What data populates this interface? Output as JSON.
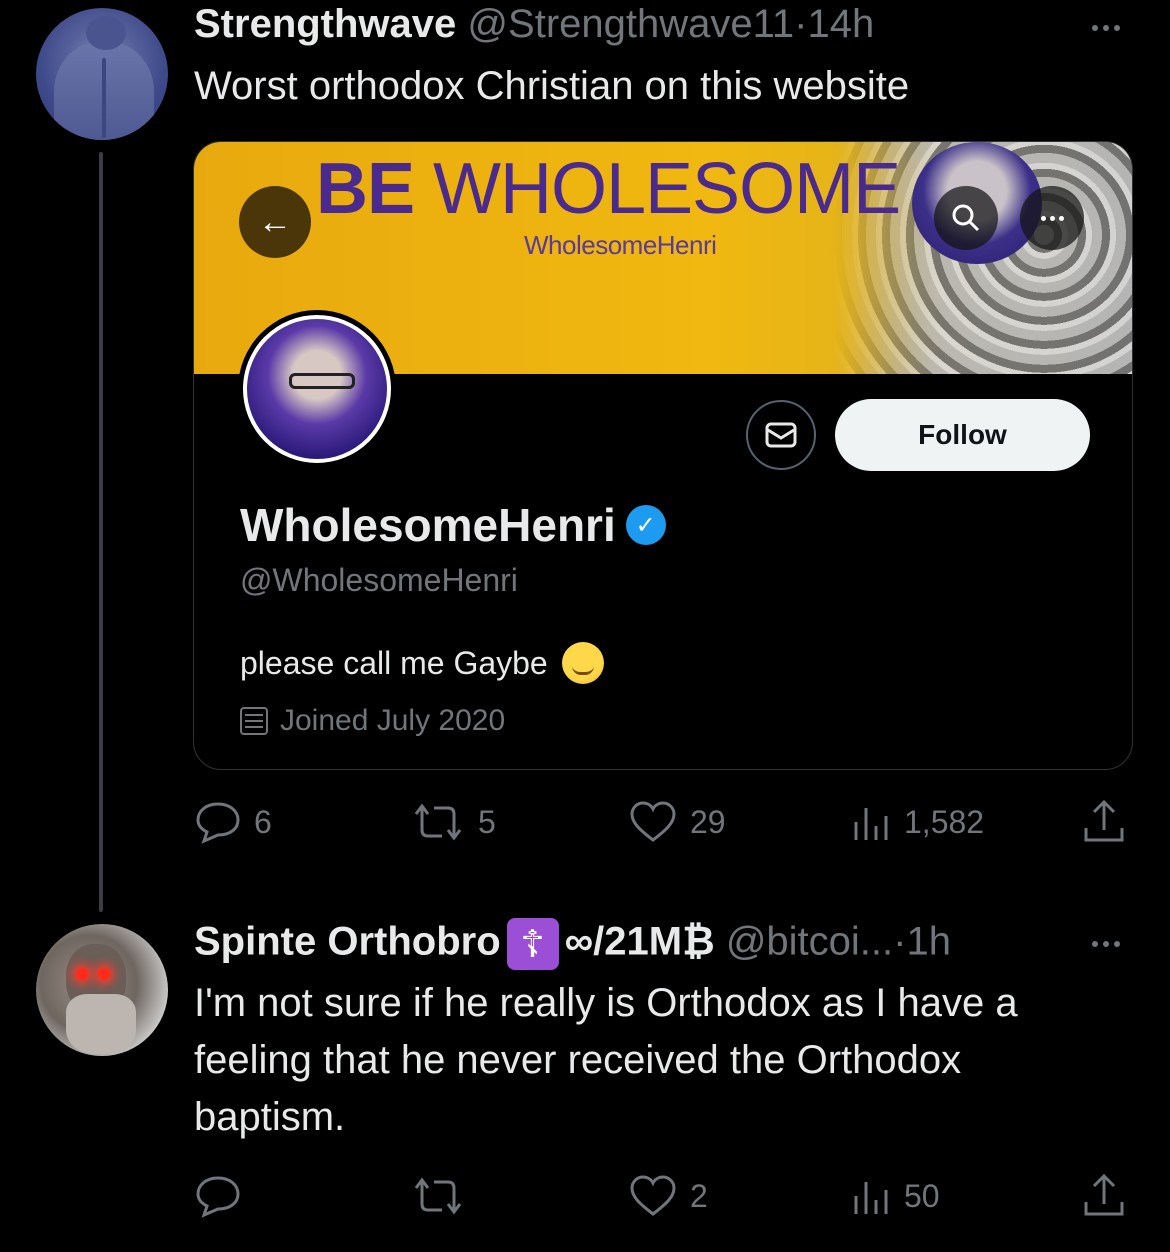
{
  "tweet1": {
    "name": "Strengthwave",
    "handle": "@Strengthwave11",
    "sep": "·",
    "time": "14h",
    "text": "Worst orthodox Christian on this website",
    "card": {
      "banner_title_bold": "BE",
      "banner_title_rest": " WHOLESOME",
      "banner_subtitle": "WholesomeHenri",
      "follow_label": "Follow",
      "display_name": "WholesomeHenri",
      "verified_mark": "✓",
      "handle": "@WholesomeHenri",
      "bio": "please call me Gaybe",
      "joined": "Joined July 2020"
    },
    "actions": {
      "replies": "6",
      "reposts": "5",
      "likes": "29",
      "views": "1,582"
    }
  },
  "tweet2": {
    "name": "Spinte Orthobro",
    "badge": "☦",
    "name_suffix": "∞/21M₿",
    "handle": "@bitcoi...",
    "sep": "·",
    "time": "1h",
    "text_lines": [
      "I'm not sure if he really is Orthodox as I have a",
      "feeling that he never received the Orthodox",
      "baptism."
    ],
    "actions": {
      "likes": "2",
      "views": "50"
    }
  },
  "colors": {
    "background": "#000000",
    "muted": "#71767b",
    "text": "#e7e9ea",
    "verified": "#1d9bf0",
    "banner": "#f0b810"
  },
  "icons": [
    "reply-icon",
    "repost-icon",
    "like-icon",
    "views-icon",
    "share-icon",
    "more-icon",
    "mail-icon",
    "search-icon",
    "back-arrow-icon",
    "calendar-icon"
  ]
}
